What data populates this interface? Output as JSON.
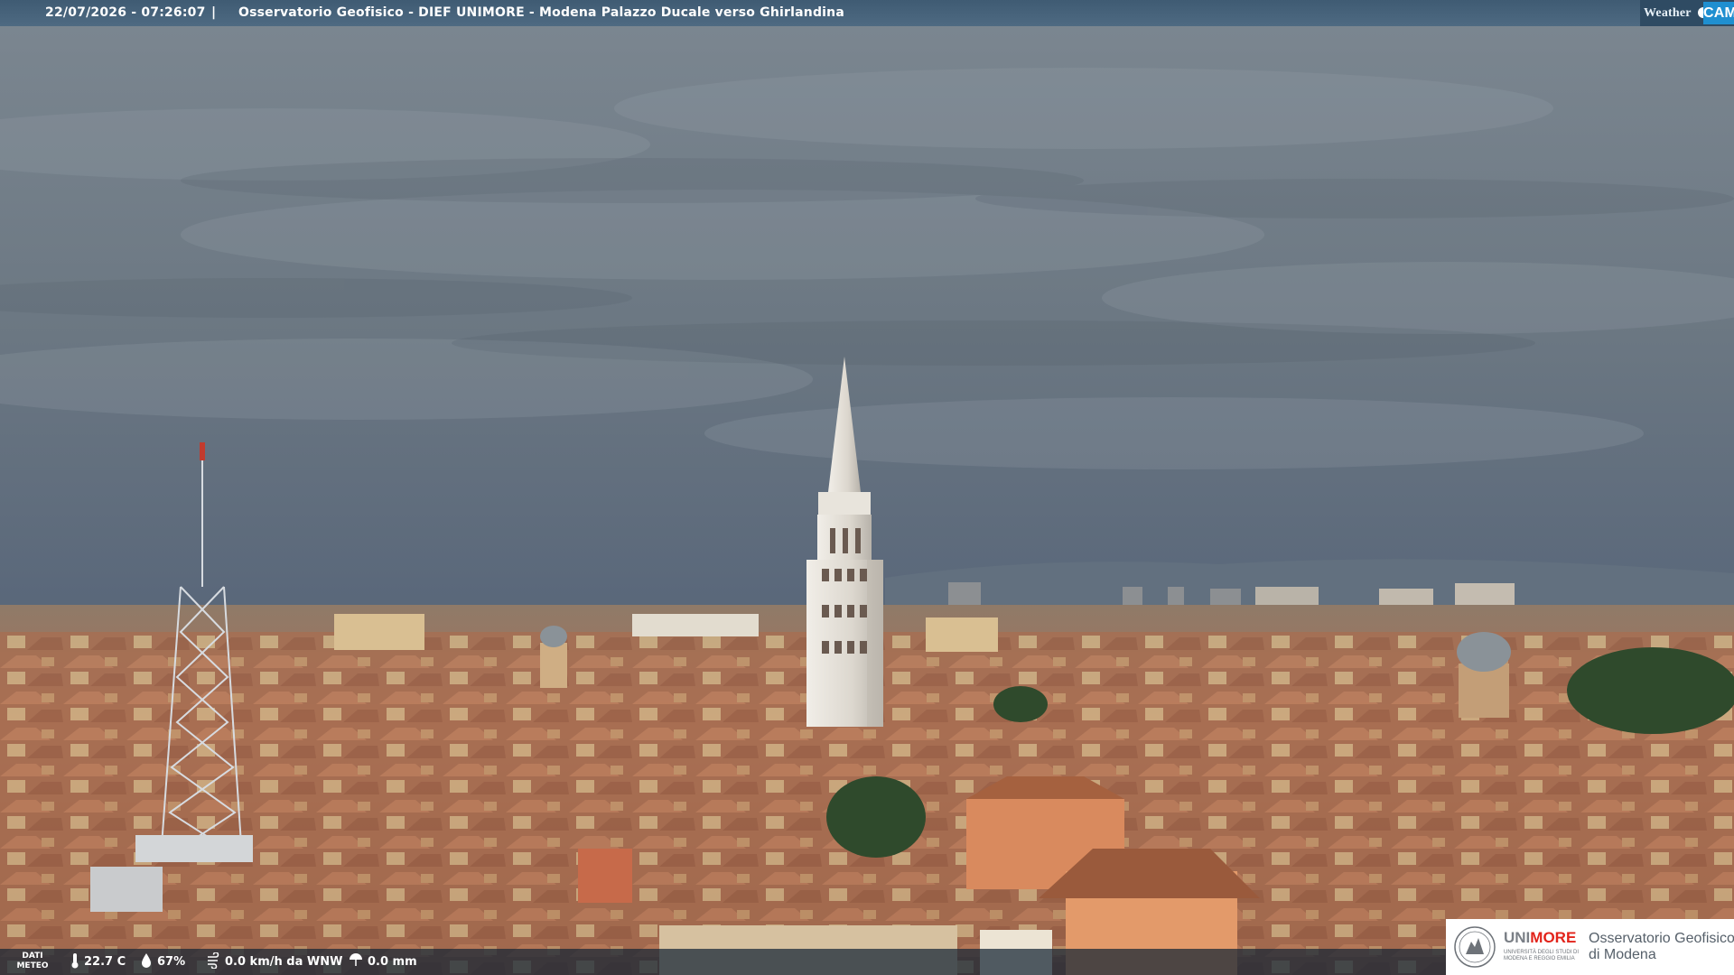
{
  "overlay": {
    "datetime": "22/07/2026 - 07:26:07",
    "separator": "|",
    "title": "Osservatorio Geofisico - DIEF UNIMORE - Modena Palazzo Ducale verso Ghirlandina",
    "brand_left": "Weather",
    "brand_right": "CAM"
  },
  "weather": {
    "label": "DATI METEO",
    "temperature": "22.7 C",
    "humidity": "67%",
    "wind": "0.0 km/h da WNW",
    "rain": "0.0 mm",
    "icons": [
      "thermometer-icon",
      "humidity-drop-icon",
      "wind-icon",
      "rain-icon"
    ]
  },
  "institution": {
    "name_gray": "UNI",
    "name_red": "MORE",
    "subtitle": "UNIVERSITÀ DEGLI STUDI DI MODENA E REGGIO EMILIA",
    "observatory": "Osservatorio Geofisico\ndi Modena"
  },
  "colors": {
    "sky": "#6f7b86",
    "roof": "#b07555",
    "tower": "#e6e2da",
    "accent": "#1f8fd0",
    "unimore_red": "#e2231a"
  }
}
